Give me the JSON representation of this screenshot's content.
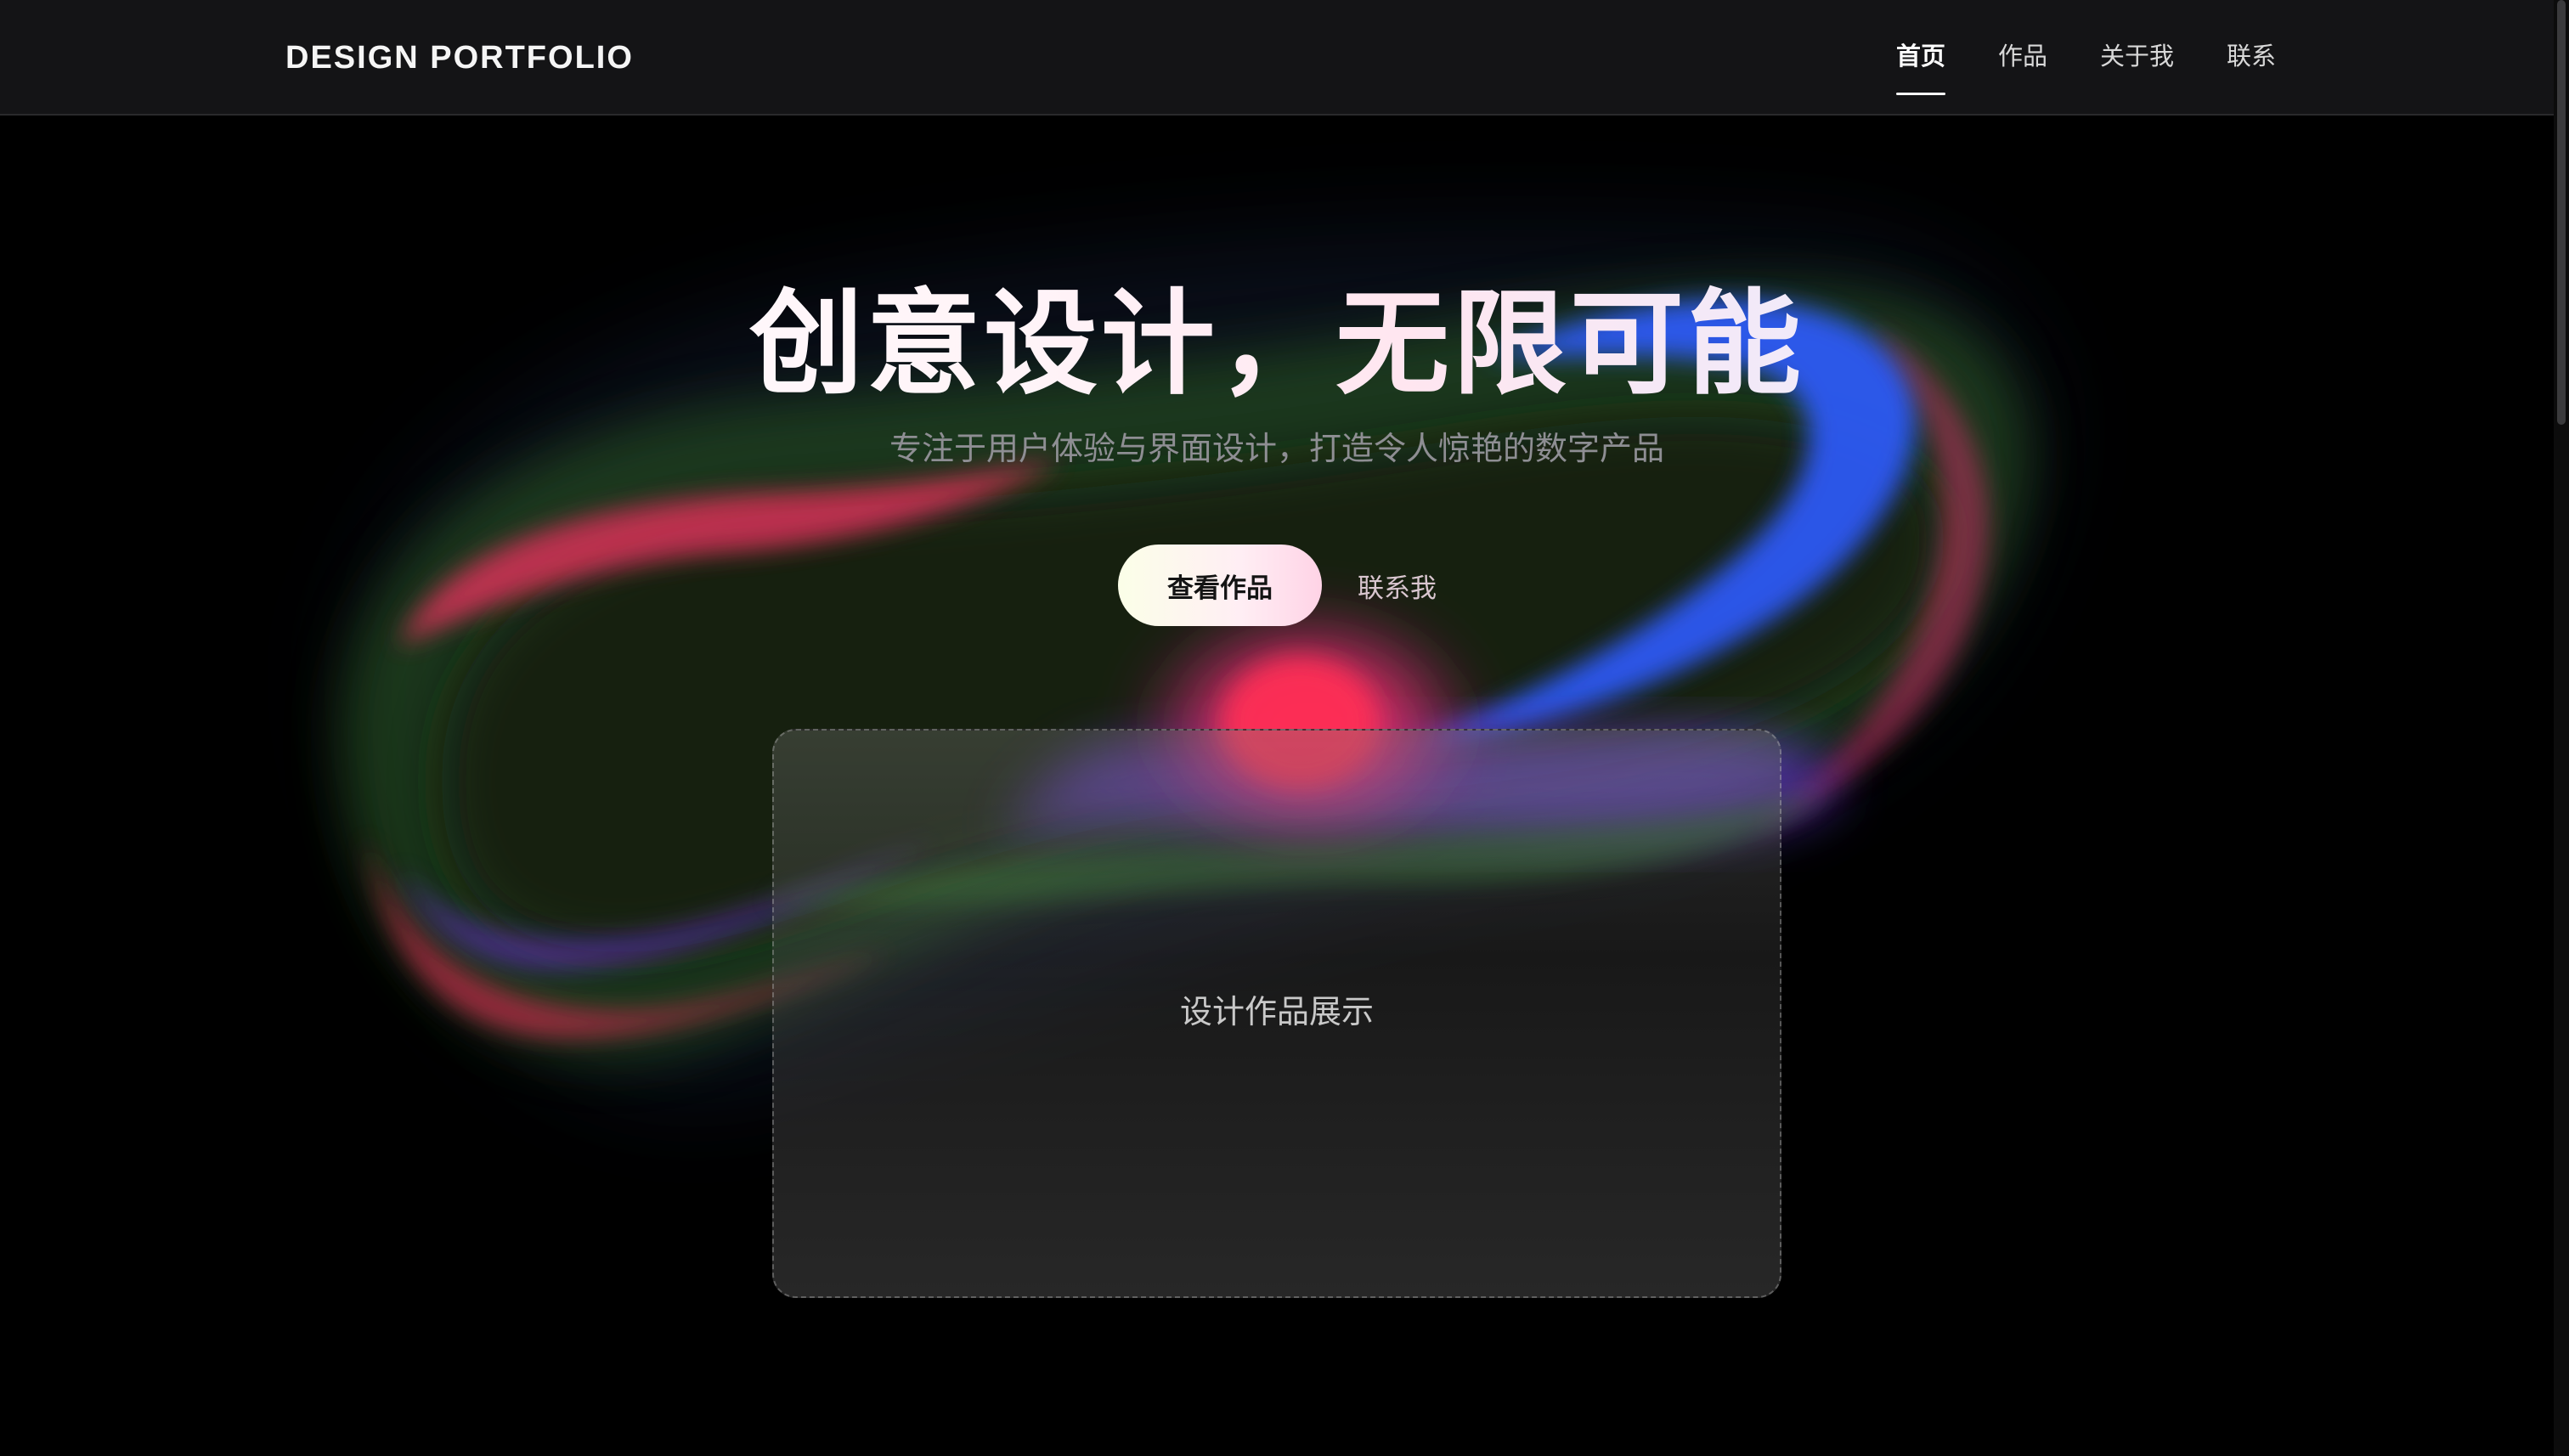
{
  "nav": {
    "brand": "DESIGN PORTFOLIO",
    "links": [
      {
        "label": "首页",
        "active": true
      },
      {
        "label": "作品",
        "active": false
      },
      {
        "label": "关于我",
        "active": false
      },
      {
        "label": "联系",
        "active": false
      }
    ]
  },
  "hero": {
    "title": "创意设计，无限可能",
    "subtitle": "专注于用户体验与界面设计，打造令人惊艳的数字产品",
    "primary_cta": "查看作品",
    "secondary_cta": "联系我"
  },
  "showcase": {
    "label": "设计作品展示"
  },
  "colors": {
    "background": "#000000",
    "nav_background": "#141416",
    "subtitle": "#8e8e93",
    "blob_pink": "#ff2d6a",
    "blob_blue": "#3a5bff",
    "blob_green": "#2f6b2a",
    "blob_purple": "#7a3cff"
  }
}
